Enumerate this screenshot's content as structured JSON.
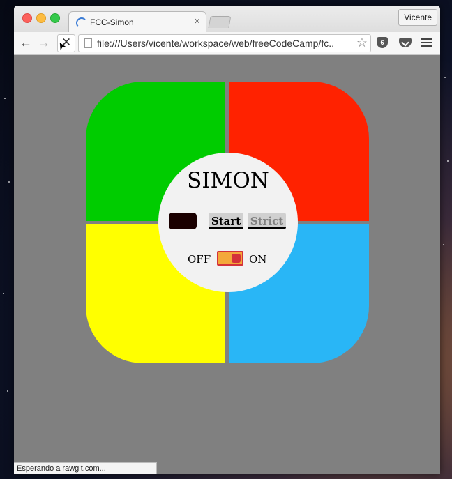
{
  "browser": {
    "tab": {
      "title": "FCC-Simon",
      "close_glyph": "×"
    },
    "profile_name": "Vicente",
    "url": "file:///Users/vicente/workspace/web/freeCodeCamp/fc...",
    "status_text": "Esperando a rawgit.com...",
    "icons": {
      "back": "←",
      "forward": "→",
      "stop": "✕",
      "bookmark": "☆",
      "extension_badge": "6"
    },
    "loading": true
  },
  "game": {
    "title": "SIMON",
    "start_label": "Start",
    "strict_label": "Strict",
    "off_label": "OFF",
    "on_label": "ON",
    "power_on": true,
    "colors": {
      "green": "#00cc00",
      "red": "#ff2200",
      "yellow": "#ffff00",
      "blue": "#29b6f6",
      "background": "#808080"
    }
  }
}
